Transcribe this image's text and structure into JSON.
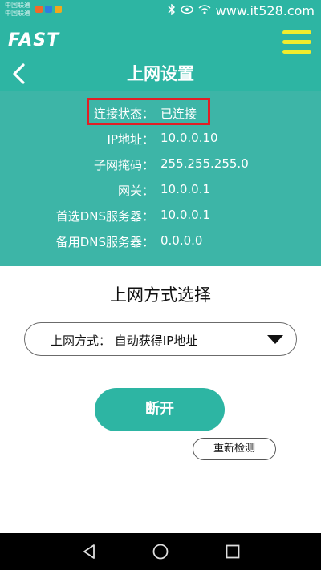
{
  "status_bar": {
    "carrier_line1": "中国联通",
    "carrier_line2": "中国联通",
    "site": "www.it528.com",
    "app_icon_colors": [
      "#f06a2a",
      "#2e7de0",
      "#f2a81d"
    ]
  },
  "header": {
    "brand": "FAST",
    "title": "上网设置"
  },
  "info": {
    "rows": [
      {
        "label": "连接状态：",
        "value": "已连接"
      },
      {
        "label": "IP地址：",
        "value": "10.0.0.10"
      },
      {
        "label": "子网掩码：",
        "value": "255.255.255.0"
      },
      {
        "label": "网关：",
        "value": "10.0.0.1"
      },
      {
        "label": "首选DNS服务器：",
        "value": "10.0.0.1"
      },
      {
        "label": "备用DNS服务器：",
        "value": "0.0.0.0"
      }
    ]
  },
  "section": {
    "title": "上网方式选择"
  },
  "select": {
    "text": "上网方式：  自动获得IP地址"
  },
  "buttons": {
    "disconnect": "断开",
    "recheck": "重新检测"
  },
  "colors": {
    "primary": "#2db5a3",
    "panel": "#3db5a7",
    "highlight": "#e11f25",
    "menu": "#f0ec2e"
  }
}
